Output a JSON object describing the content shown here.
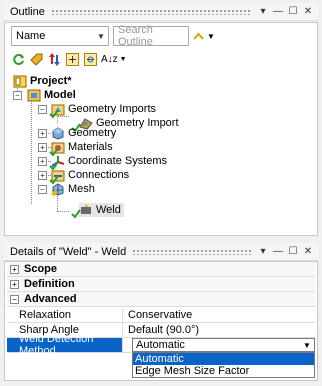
{
  "outline": {
    "title": "Outline",
    "window_buttons": [
      "▾",
      "—",
      "☐",
      "✕"
    ],
    "name_combo_value": "Name",
    "search_placeholder": "Search Outline",
    "sort_label": "A↓z",
    "tree": [
      {
        "label": "Project*",
        "icon": "project-icon"
      },
      {
        "label": "Model",
        "icon": "model-icon"
      },
      {
        "label": "Geometry Imports",
        "icon": "geometry-imports-icon"
      },
      {
        "label": "Geometry Import",
        "icon": "geometry-import-icon"
      },
      {
        "label": "Geometry",
        "icon": "geometry-icon"
      },
      {
        "label": "Materials",
        "icon": "materials-icon"
      },
      {
        "label": "Coordinate Systems",
        "icon": "coordinate-systems-icon"
      },
      {
        "label": "Connections",
        "icon": "connections-icon"
      },
      {
        "label": "Mesh",
        "icon": "mesh-icon"
      },
      {
        "label": "Weld",
        "icon": "weld-icon"
      }
    ]
  },
  "details": {
    "title": "Details of \"Weld\" - Weld",
    "window_buttons": [
      "▾",
      "—",
      "☐",
      "✕"
    ],
    "sections": [
      "Scope",
      "Definition",
      "Advanced"
    ],
    "properties": [
      {
        "key": "Relaxation",
        "value": "Conservative"
      },
      {
        "key": "Sharp Angle",
        "value": "Default (90.0°)"
      },
      {
        "key": "Weld Detection Method",
        "value": "Automatic"
      }
    ],
    "dropdown_options": [
      "Automatic",
      "Edge Mesh Size Factor"
    ]
  },
  "colors": {
    "selection": "#0a64c8",
    "check_green": "#2e9e2e"
  }
}
